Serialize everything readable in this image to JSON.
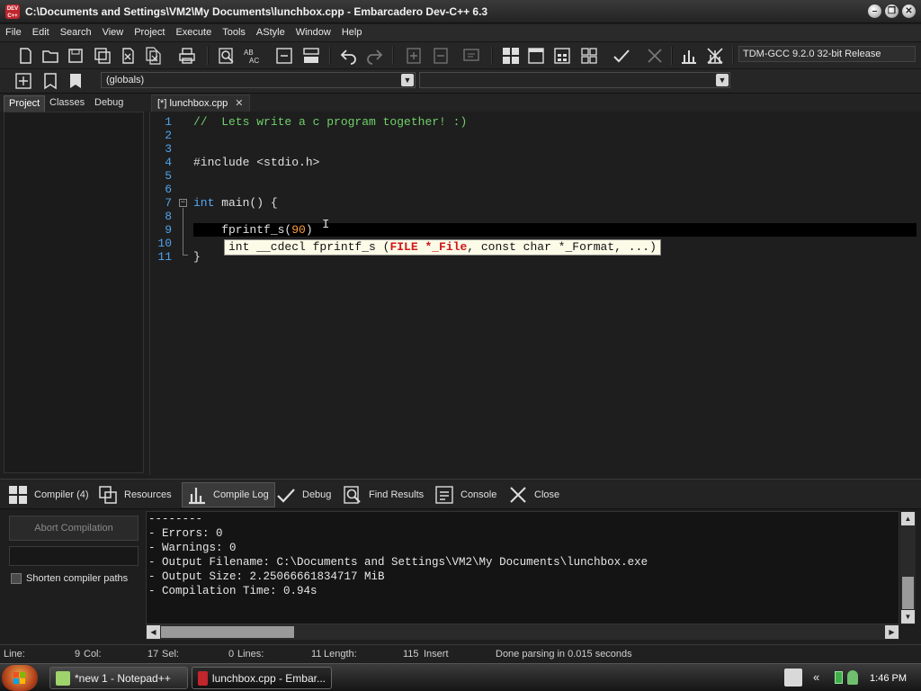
{
  "window": {
    "title": "C:\\Documents and Settings\\VM2\\My Documents\\lunchbox.cpp - Embarcadero Dev-C++ 6.3",
    "icon_label": "DEV\nC++"
  },
  "menu": [
    "File",
    "Edit",
    "Search",
    "View",
    "Project",
    "Execute",
    "Tools",
    "AStyle",
    "Window",
    "Help"
  ],
  "toolbar": {
    "compiler": "TDM-GCC 9.2.0 32-bit Release",
    "class_combo": "(globals)",
    "member_combo": ""
  },
  "left_tabs": [
    "Project",
    "Classes",
    "Debug"
  ],
  "editor": {
    "tab_label": "[*] lunchbox.cpp",
    "tab_close": "✕",
    "line_numbers": [
      "1",
      "2",
      "3",
      "4",
      "5",
      "6",
      "7",
      "8",
      "9",
      "10",
      "11"
    ],
    "lines": {
      "l1": "//  Lets write a c program together! :)",
      "l4": "#include <stdio.h>",
      "l7_kw": "int",
      "l7_rest": " main() {",
      "l9_a": "    fprintf_s(",
      "l9_num": "90",
      "l9_b": ")",
      "l11": "}"
    },
    "calltip": {
      "prefix": "int __cdecl fprintf_s (",
      "param": "FILE *_File",
      "suffix": ", const char *_Format, ...)"
    }
  },
  "bottom_tabs": [
    "Compiler (4)",
    "Resources",
    "Compile Log",
    "Debug",
    "Find Results",
    "Console",
    "Close"
  ],
  "compiler_panel": {
    "abort_label": "Abort Compilation",
    "shorten_label": "Shorten compiler paths"
  },
  "log_lines": [
    "--------",
    "- Errors: 0",
    "- Warnings: 0",
    "- Output Filename: C:\\Documents and Settings\\VM2\\My Documents\\lunchbox.exe",
    "- Output Size: 2.25066661834717 MiB",
    "- Compilation Time: 0.94s"
  ],
  "status": {
    "line_label": "Line:",
    "line_val": "9",
    "col_label": "Col:",
    "col_val": "17",
    "sel_label": "Sel:",
    "sel_val": "0",
    "lines_label": "Lines:",
    "lines_val": "11",
    "length_label": "Length:",
    "length_val": "115",
    "mode": "Insert",
    "message": "Done parsing in 0.015 seconds"
  },
  "taskbar": {
    "items": [
      "*new 1 - Notepad++",
      "lunchbox.cpp - Embar..."
    ],
    "tray_chevron": "«",
    "clock": "1:46 PM"
  },
  "colors": {
    "line_number": "#4fa3ea",
    "comment": "#6fcf6a",
    "keyword": "#56a8f5",
    "number": "#ff9b3b",
    "calltip_highlight": "#d01818"
  }
}
